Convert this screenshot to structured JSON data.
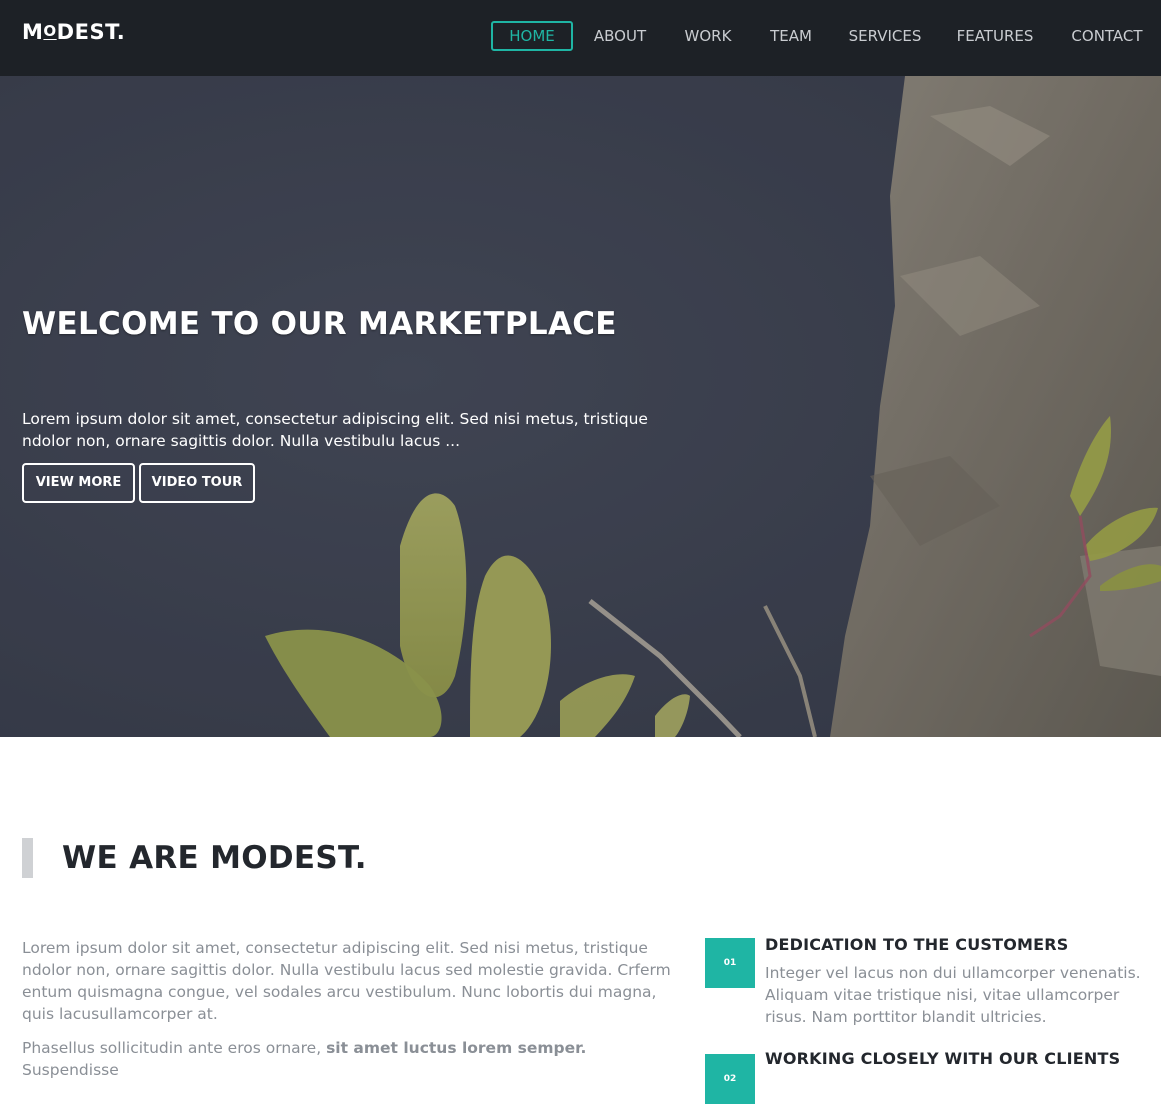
{
  "header": {
    "logo_prefix": "M",
    "logo_o": "O",
    "logo_suffix": "DEST."
  },
  "nav": {
    "items": [
      {
        "label": "HOME",
        "active": true
      },
      {
        "label": "ABOUT",
        "active": false
      },
      {
        "label": "WORK",
        "active": false
      },
      {
        "label": "TEAM",
        "active": false
      },
      {
        "label": "SERVICES",
        "active": false
      },
      {
        "label": "FEATURES",
        "active": false
      },
      {
        "label": "CONTACT",
        "active": false
      }
    ]
  },
  "hero": {
    "title": "WELCOME TO OUR MARKETPLACE",
    "text": "Lorem ipsum dolor sit amet, consectetur adipiscing elit. Sed nisi metus, tristique ndolor non, ornare sagittis dolor. Nulla vestibulu lacus ...",
    "view_more_label": "VIEW MORE",
    "video_tour_label": "VIDEO TOUR"
  },
  "about": {
    "title": "WE ARE MODEST.",
    "para1": "Lorem ipsum dolor sit amet, consectetur adipiscing elit. Sed nisi metus, tristique ndolor non, ornare sagittis dolor. Nulla vestibulu lacus sed molestie gravida. Crferm entum quismagna congue, vel sodales arcu vestibulum. Nunc lobortis dui magna, quis lacusullamcorper at.",
    "para2_start": "Phasellus sollicitudin ante eros ornare, ",
    "para2_bold": "sit amet luctus lorem semper.",
    "para2_end": " Suspendisse",
    "features": [
      {
        "number": "01",
        "title": "DEDICATION TO THE CUSTOMERS",
        "text": "Integer vel lacus non dui ullamcorper venenatis. Aliquam vitae tristique nisi, vitae ullamcorper risus. Nam porttitor blandit ultricies."
      },
      {
        "number": "02",
        "title": "WORKING CLOSELY WITH OUR CLIENTS",
        "text": ""
      }
    ]
  },
  "colors": {
    "accent": "#1fb5a4",
    "navbar": "#1d2126",
    "heading": "#23272d",
    "body_text": "#8a8f96"
  }
}
